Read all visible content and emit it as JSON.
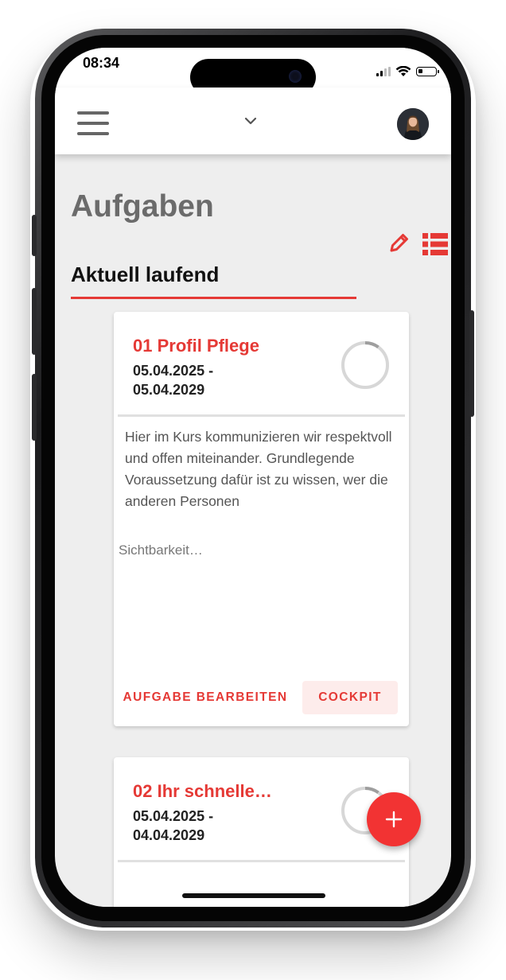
{
  "status_bar": {
    "time": "08:34",
    "signal_icon": "cellular-signal-icon",
    "wifi_icon": "wifi-icon",
    "battery_icon": "battery-icon",
    "battery_level": 0.25
  },
  "app_bar": {
    "menu_icon": "hamburger-menu-icon",
    "dropdown_icon": "chevron-down-icon",
    "avatar": "user-avatar"
  },
  "page": {
    "title": "Aufgaben",
    "edit_icon": "pencil-icon",
    "list_icon": "list-view-icon"
  },
  "section": {
    "heading": "Aktuell laufend"
  },
  "cards": [
    {
      "title": "01 Profil Pflege",
      "date_start": "05.04.2025 -",
      "date_end": "05.04.2029",
      "progress": 0.1,
      "description": "Hier im Kurs kommunizieren wir respektvoll und offen miteinander. Grundlegende Voraussetzung dafür ist zu wissen, wer die anderen Personen",
      "visibility": "Sichtbarkeit…",
      "edit_label": "AUFGABE BEARBEITEN",
      "cockpit_label": "COCKPIT"
    },
    {
      "title": "02 Ihr schnelle…",
      "date_start": "05.04.2025 -",
      "date_end": "04.04.2029",
      "progress": 0.1
    }
  ],
  "fab": {
    "icon": "plus-icon"
  },
  "colors": {
    "accent": "#e53935",
    "fab": "#f23333",
    "cockpit_bg": "#fdeceb",
    "screen_bg": "#eeeeee"
  }
}
